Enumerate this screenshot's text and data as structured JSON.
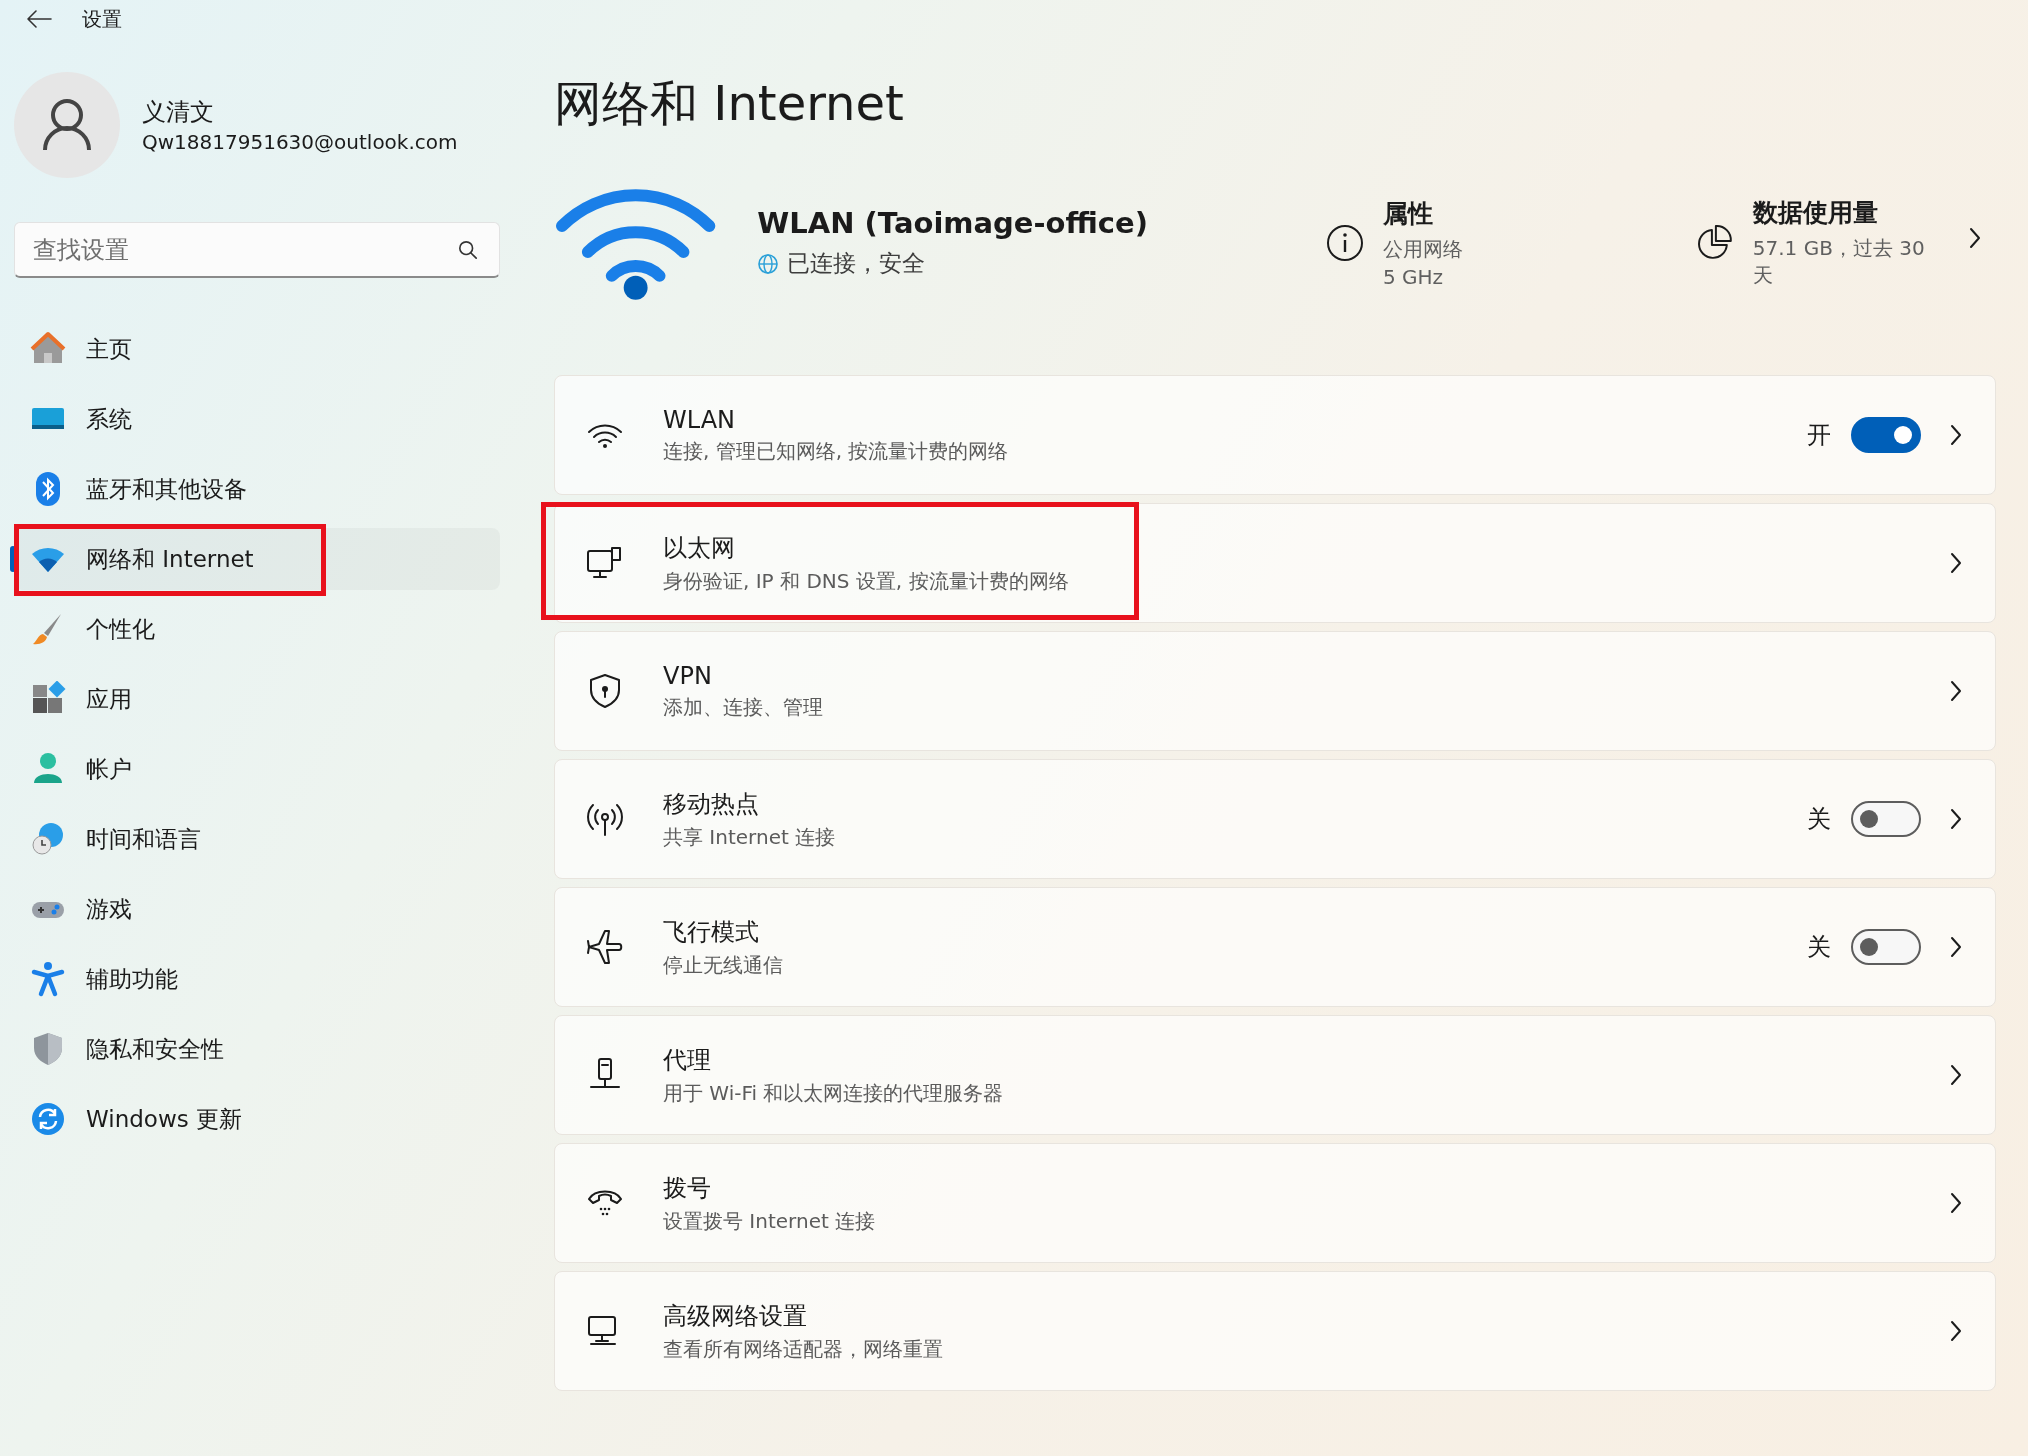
{
  "window": {
    "title": "设置"
  },
  "account": {
    "name": "义清文",
    "email": "Qw18817951630@outlook.com"
  },
  "search": {
    "placeholder": "查找设置"
  },
  "sidebar": {
    "items": [
      {
        "label": "主页",
        "selected": false,
        "highlighted": false
      },
      {
        "label": "系统",
        "selected": false,
        "highlighted": false
      },
      {
        "label": "蓝牙和其他设备",
        "selected": false,
        "highlighted": false
      },
      {
        "label": "网络和 Internet",
        "selected": true,
        "highlighted": true
      },
      {
        "label": "个性化",
        "selected": false,
        "highlighted": false
      },
      {
        "label": "应用",
        "selected": false,
        "highlighted": false
      },
      {
        "label": "帐户",
        "selected": false,
        "highlighted": false
      },
      {
        "label": "时间和语言",
        "selected": false,
        "highlighted": false
      },
      {
        "label": "游戏",
        "selected": false,
        "highlighted": false
      },
      {
        "label": "辅助功能",
        "selected": false,
        "highlighted": false
      },
      {
        "label": "隐私和安全性",
        "selected": false,
        "highlighted": false
      },
      {
        "label": "Windows 更新",
        "selected": false,
        "highlighted": false
      }
    ]
  },
  "page": {
    "title": "网络和 Internet"
  },
  "connection": {
    "name": "WLAN (Taoimage-office)",
    "status": "已连接，安全"
  },
  "properties": {
    "label": "属性",
    "network_type": "公用网络",
    "band": "5 GHz"
  },
  "data_usage": {
    "label": "数据使用量",
    "summary": "57.1 GB，过去 30 天"
  },
  "settings": [
    {
      "kind": "toggle",
      "title": "WLAN",
      "subtitle": "连接, 管理已知网络, 按流量计费的网络",
      "state_label": "开",
      "on": true,
      "highlighted": false
    },
    {
      "kind": "link",
      "title": "以太网",
      "subtitle": "身份验证, IP 和 DNS 设置, 按流量计费的网络",
      "highlighted": true
    },
    {
      "kind": "link",
      "title": "VPN",
      "subtitle": "添加、连接、管理",
      "highlighted": false
    },
    {
      "kind": "toggle",
      "title": "移动热点",
      "subtitle": "共享 Internet 连接",
      "state_label": "关",
      "on": false,
      "highlighted": false
    },
    {
      "kind": "toggle",
      "title": "飞行模式",
      "subtitle": "停止无线通信",
      "state_label": "关",
      "on": false,
      "highlighted": false
    },
    {
      "kind": "link",
      "title": "代理",
      "subtitle": "用于 Wi-Fi 和以太网连接的代理服务器",
      "highlighted": false
    },
    {
      "kind": "link",
      "title": "拨号",
      "subtitle": "设置拨号 Internet 连接",
      "highlighted": false
    },
    {
      "kind": "link",
      "title": "高级网络设置",
      "subtitle": "查看所有网络适配器，网络重置",
      "highlighted": false
    }
  ]
}
